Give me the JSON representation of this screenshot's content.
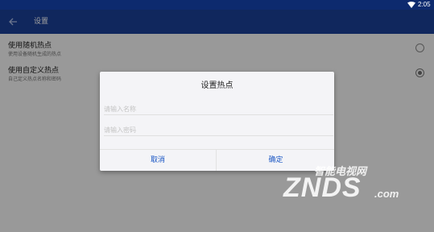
{
  "status_bar": {
    "time": "2:05",
    "icons": [
      "wifi-icon"
    ]
  },
  "app_bar": {
    "title": "设置",
    "back_icon": "arrow-left-icon"
  },
  "settings": {
    "items": [
      {
        "title": "使用随机热点",
        "subtitle": "使用设备随机生成的热点",
        "checked": false
      },
      {
        "title": "使用自定义热点",
        "subtitle": "自己定义热点名称和密码",
        "checked": true
      }
    ]
  },
  "dialog": {
    "title": "设置热点",
    "name_placeholder": "请输入名称",
    "password_placeholder": "请输入密码",
    "cancel_label": "取消",
    "confirm_label": "确定"
  },
  "watermark": {
    "cn": "智能电视网",
    "logo": "ZNDS",
    "suffix": ".com"
  },
  "colors": {
    "status_bar": "#0d2a6e",
    "app_bar": "#1a3f97",
    "button_text": "#1a56c4"
  }
}
